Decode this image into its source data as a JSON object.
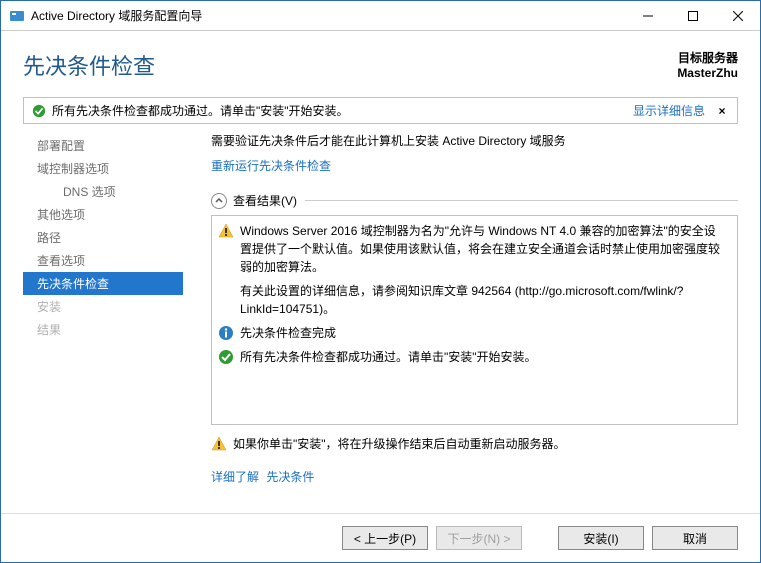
{
  "window": {
    "title": "Active Directory 域服务配置向导"
  },
  "header": {
    "page_title": "先决条件检查",
    "target_label": "目标服务器",
    "target_server": "MasterZhu"
  },
  "status": {
    "text": "所有先决条件检查都成功通过。请单击\"安装\"开始安装。",
    "show_details": "显示详细信息",
    "close_x": "×"
  },
  "sidebar": {
    "items": [
      {
        "label": "部署配置"
      },
      {
        "label": "域控制器选项"
      },
      {
        "label": "DNS 选项",
        "sub": true
      },
      {
        "label": "其他选项"
      },
      {
        "label": "路径"
      },
      {
        "label": "查看选项"
      },
      {
        "label": "先决条件检查",
        "selected": true
      },
      {
        "label": "安装",
        "disabled": true
      },
      {
        "label": "结果",
        "disabled": true
      }
    ]
  },
  "main": {
    "intro": "需要验证先决条件后才能在此计算机上安装 Active Directory 域服务",
    "rerun_link": "重新运行先决条件检查",
    "section_title": "查看结果(V)",
    "results": [
      {
        "icon": "warning",
        "text": "Windows Server 2016 域控制器为名为\"允许与 Windows NT 4.0 兼容的加密算法\"的安全设置提供了一个默认值。如果使用该默认值，将会在建立安全通道会话时禁止使用加密强度较弱的加密算法。"
      },
      {
        "icon": "none",
        "text": "有关此设置的详细信息，请参阅知识库文章 942564 (http://go.microsoft.com/fwlink/?LinkId=104751)。"
      },
      {
        "icon": "info",
        "text": "先决条件检查完成"
      },
      {
        "icon": "success",
        "text": "所有先决条件检查都成功通过。请单击\"安装\"开始安装。"
      }
    ],
    "warning_footer": "如果你单击\"安装\"，将在升级操作结束后自动重新启动服务器。",
    "footer_link1": "详细了解",
    "footer_link2": "先决条件"
  },
  "buttons": {
    "prev": "< 上一步(P)",
    "next": "下一步(N) >",
    "install": "安装(I)",
    "cancel": "取消"
  }
}
